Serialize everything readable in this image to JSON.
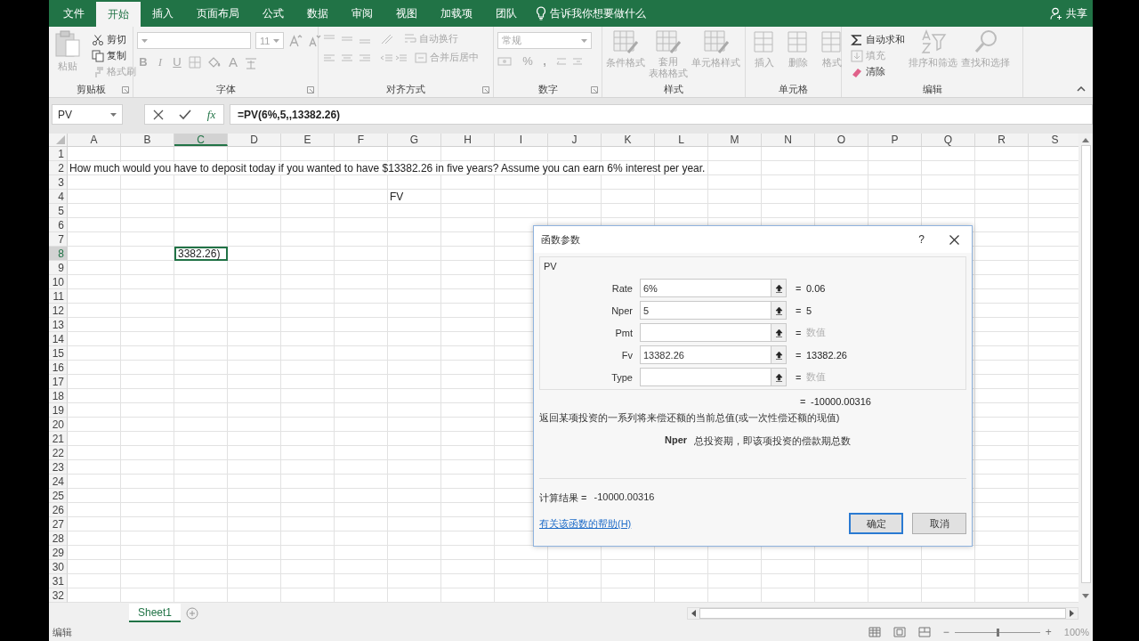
{
  "tabs": [
    {
      "label": "文件",
      "selected": false
    },
    {
      "label": "开始",
      "selected": true
    },
    {
      "label": "插入",
      "selected": false
    },
    {
      "label": "页面布局",
      "selected": false
    },
    {
      "label": "公式",
      "selected": false
    },
    {
      "label": "数据",
      "selected": false
    },
    {
      "label": "审阅",
      "selected": false
    },
    {
      "label": "视图",
      "selected": false
    },
    {
      "label": "加载项",
      "selected": false
    },
    {
      "label": "团队",
      "selected": false
    }
  ],
  "tell_me": "告诉我你想要做什么",
  "share": "共享",
  "ribbon": {
    "groups": [
      {
        "label": "剪贴板",
        "buttons": [
          {
            "label": "粘贴",
            "disabled": true
          },
          {
            "label": "剪切",
            "disabled": false
          },
          {
            "label": "复制",
            "disabled": false
          },
          {
            "label": "格式刷",
            "disabled": true
          }
        ]
      },
      {
        "label": "字体",
        "font_size": "11",
        "buttons": [
          {
            "label": "B",
            "disabled": true
          },
          {
            "label": "I",
            "disabled": true
          },
          {
            "label": "U",
            "disabled": true
          },
          {
            "label": "A",
            "disabled": true
          }
        ]
      },
      {
        "label": "对齐方式",
        "buttons": [
          {
            "label": "自动换行",
            "disabled": true
          },
          {
            "label": "合并后居中",
            "disabled": true
          }
        ]
      },
      {
        "label": "数字",
        "format": "常规",
        "buttons": [
          {
            "label": "%",
            "disabled": true
          },
          {
            "label": ",",
            "disabled": true
          }
        ]
      },
      {
        "label": "样式",
        "buttons": [
          {
            "label": "条件格式",
            "disabled": true
          },
          {
            "lines": [
              "套用",
              "表格格式"
            ],
            "disabled": true
          },
          {
            "label": "单元格样式",
            "disabled": true
          }
        ]
      },
      {
        "label": "单元格",
        "buttons": [
          {
            "label": "插入",
            "disabled": true
          },
          {
            "label": "删除",
            "disabled": true
          },
          {
            "label": "格式",
            "disabled": true
          }
        ]
      },
      {
        "label": "编辑",
        "buttons": [
          {
            "label": "自动求和",
            "disabled": false
          },
          {
            "label": "填充",
            "disabled": true
          },
          {
            "label": "清除",
            "disabled": false
          },
          {
            "label": "排序和筛选",
            "disabled": true
          },
          {
            "label": "查找和选择",
            "disabled": true
          }
        ]
      }
    ]
  },
  "formula_bar": {
    "name_box": "PV",
    "fx": "fx",
    "formula": "=PV(6%,5,,13382.26)"
  },
  "columns": [
    {
      "label": "A",
      "selected": false
    },
    {
      "label": "B",
      "selected": false
    },
    {
      "label": "C",
      "selected": true
    },
    {
      "label": "D",
      "selected": false
    },
    {
      "label": "E",
      "selected": false
    },
    {
      "label": "F",
      "selected": false
    },
    {
      "label": "G",
      "selected": false
    },
    {
      "label": "H",
      "selected": false
    },
    {
      "label": "I",
      "selected": false
    },
    {
      "label": "J",
      "selected": false
    },
    {
      "label": "K",
      "selected": false
    },
    {
      "label": "L",
      "selected": false
    },
    {
      "label": "M",
      "selected": false
    },
    {
      "label": "N",
      "selected": false
    },
    {
      "label": "O",
      "selected": false
    },
    {
      "label": "P",
      "selected": false
    },
    {
      "label": "Q",
      "selected": false
    },
    {
      "label": "R",
      "selected": false
    },
    {
      "label": "S",
      "selected": false
    }
  ],
  "rows": [
    {
      "label": "1",
      "selected": false
    },
    {
      "label": "2",
      "selected": false,
      "cells": {
        "A": {
          "text": "How much would you have to deposit today if you wanted to have $13382.26 in five years? Assume you can earn 6% interest per year.",
          "selected": false
        }
      }
    },
    {
      "label": "3",
      "selected": false
    },
    {
      "label": "4",
      "selected": false,
      "cells": {
        "G": {
          "text": "FV",
          "selected": false
        }
      }
    },
    {
      "label": "5",
      "selected": false
    },
    {
      "label": "6",
      "selected": false
    },
    {
      "label": "7",
      "selected": false
    },
    {
      "label": "8",
      "selected": true,
      "cells": {
        "C": {
          "text": "3382.26)",
          "selected": true
        }
      }
    },
    {
      "label": "9",
      "selected": false
    },
    {
      "label": "10",
      "selected": false
    },
    {
      "label": "11",
      "selected": false
    },
    {
      "label": "12",
      "selected": false
    },
    {
      "label": "13",
      "selected": false
    },
    {
      "label": "14",
      "selected": false
    },
    {
      "label": "15",
      "selected": false
    },
    {
      "label": "16",
      "selected": false
    },
    {
      "label": "17",
      "selected": false
    },
    {
      "label": "18",
      "selected": false
    },
    {
      "label": "19",
      "selected": false
    },
    {
      "label": "20",
      "selected": false
    },
    {
      "label": "21",
      "selected": false
    },
    {
      "label": "22",
      "selected": false
    },
    {
      "label": "23",
      "selected": false
    },
    {
      "label": "24",
      "selected": false
    },
    {
      "label": "25",
      "selected": false
    },
    {
      "label": "26",
      "selected": false
    },
    {
      "label": "27",
      "selected": false
    },
    {
      "label": "28",
      "selected": false
    },
    {
      "label": "29",
      "selected": false
    },
    {
      "label": "30",
      "selected": false
    },
    {
      "label": "31",
      "selected": false
    },
    {
      "label": "32",
      "selected": false
    }
  ],
  "dialog": {
    "title": "函数参数",
    "help": "?",
    "function": "PV",
    "args": [
      {
        "name": "Rate",
        "value": "6%",
        "equals": "=",
        "result": "0.06",
        "hint": false
      },
      {
        "name": "Nper",
        "value": "5",
        "equals": "=",
        "result": "5",
        "hint": false
      },
      {
        "name": "Pmt",
        "equals": "=",
        "result": "数值",
        "hint": true
      },
      {
        "name": "Fv",
        "value": "13382.26",
        "equals": "=",
        "result": "13382.26",
        "hint": false
      },
      {
        "name": "Type",
        "equals": "=",
        "result": "数值",
        "hint": true
      }
    ],
    "total": {
      "equals": "=",
      "value": "-10000.00316"
    },
    "description": "返回某项投资的一系列将来偿还额的当前总值(或一次性偿还额的现值)",
    "arg_help": {
      "name": "Nper",
      "text": "总投资期，即该项投资的偿款期总数"
    },
    "result_label": "计算结果 =",
    "result_value": "-10000.00316",
    "help_link": "有关该函数的帮助(H)",
    "buttons": [
      {
        "label": "确定",
        "default": true
      },
      {
        "label": "取消",
        "default": false
      }
    ]
  },
  "sheet_tabs": [
    {
      "label": "Sheet1",
      "selected": true
    }
  ],
  "status": {
    "mode": "编辑",
    "minus": "−",
    "plus": "+",
    "zoom": "100%",
    "zoom_slider": {
      "level": 0.5
    }
  }
}
